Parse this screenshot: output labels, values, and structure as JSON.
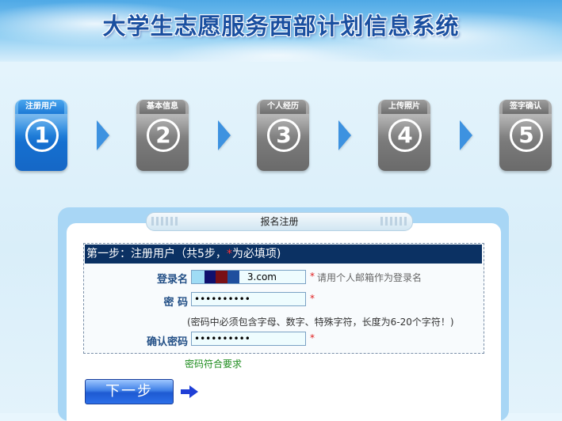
{
  "header": {
    "title": "大学生志愿服务西部计划信息系统"
  },
  "steps": [
    {
      "tab": "注册用户",
      "num": "1",
      "active": true
    },
    {
      "tab": "基本信息",
      "num": "2",
      "active": false
    },
    {
      "tab": "个人经历",
      "num": "3",
      "active": false
    },
    {
      "tab": "上传照片",
      "num": "4",
      "active": false
    },
    {
      "tab": "签字确认",
      "num": "5",
      "active": false
    }
  ],
  "panel": {
    "title": "报名注册"
  },
  "form": {
    "heading_main": "第一步：注册用户（共5步，",
    "heading_star": "*",
    "heading_tail": "为必填项)",
    "email": {
      "label": "登录名",
      "value": "3.com",
      "required_mark": "*",
      "hint": "请用个人邮箱作为登录名"
    },
    "password": {
      "label": "密 码",
      "value": "••••••••••",
      "required_mark": "*"
    },
    "password_rule": "(密码中必须包含字母、数字、特殊字符，长度为6-20个字符！)",
    "confirm": {
      "label": "确认密码",
      "value": "••••••••••",
      "required_mark": "*"
    },
    "validation_msg": "密码符合要求"
  },
  "actions": {
    "next_label": "下一步"
  },
  "colors": {
    "accent": "#0b3163",
    "required": "#e02020",
    "valid": "#1e8c1e",
    "active_step": "#1570d0"
  }
}
